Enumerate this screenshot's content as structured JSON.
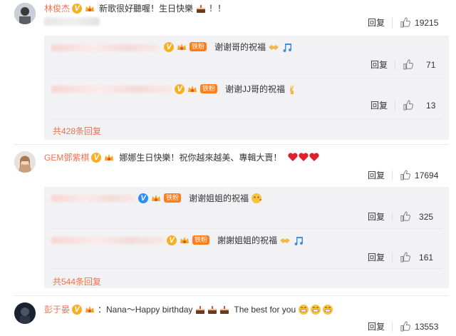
{
  "comments": [
    {
      "author": "林俊杰",
      "text_pre": "新歌很好聽喔！生日快樂",
      "text_post": "！！",
      "reply_label": "回复",
      "likes": "19215",
      "replies": [
        {
          "text": "谢谢哥的祝福",
          "reply_label": "回复",
          "likes": "71",
          "fan_label": "铁粉"
        },
        {
          "text": "谢谢JJ哥的祝福",
          "reply_label": "回复",
          "likes": "13",
          "fan_label": "铁粉"
        }
      ],
      "more_replies": "共428条回复"
    },
    {
      "author": "GEM鄧紫棋",
      "text": "娜娜生日快樂！祝你越來越美、專輯大賣！",
      "reply_label": "回复",
      "likes": "17694",
      "replies": [
        {
          "text": "谢谢姐姐的祝福",
          "reply_label": "回复",
          "likes": "325",
          "fan_label": "铁粉"
        },
        {
          "text": "謝謝姐姐的祝福",
          "reply_label": "回复",
          "likes": "161",
          "fan_label": "铁粉"
        }
      ],
      "more_replies": "共544条回复"
    },
    {
      "author": "彭于晏",
      "text_pre": "：Nana～Happy birthday",
      "text_post": "The best for you",
      "reply_label": "回复",
      "likes": "13553"
    }
  ],
  "icons": {
    "verified": "V",
    "thumb": "thumb-up-icon",
    "colors": {
      "accent": "#eb7350",
      "verified_gold": "#f6b024",
      "verified_blue": "#2b8ef8",
      "fan": "#ff7d1a"
    }
  }
}
